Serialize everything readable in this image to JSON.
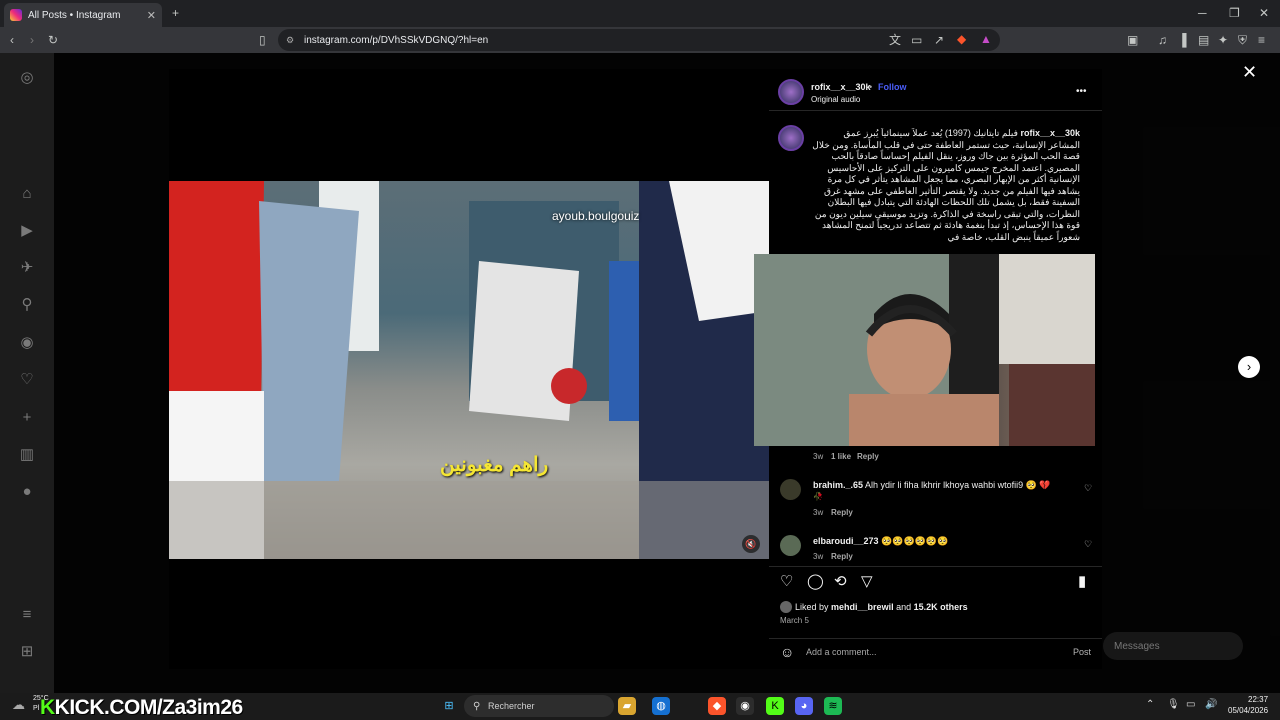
{
  "browser": {
    "tab_title": "All Posts • Instagram",
    "new_tab": "+",
    "url": "instagram.com/p/DVhSSkVDGNQ/?hl=en"
  },
  "post": {
    "username": "rofix__x__30k",
    "separator": "•",
    "follow_label": "Follow",
    "audio": "Original audio",
    "more_label": "•••",
    "video_watermark": "ayoub.boulgouiz",
    "video_caption": "راهم مغبونين",
    "caption_author": "rofix__x__30k",
    "caption_body": "فيلم تايتانيك (1997) يُعد عملاً سينمائياً يُبرز عمق المشاعر الإنسانية، حيث تستمر العاطفة حتى في قلب المأساة. ومن خلال قصة الحب المؤثرة بين جاك وروز، ينقل الفيلم إحساساً صادقاً بالحب المصيري. اعتمد المخرج جيمس كاميرون على التركيز على الأحاسيس الإنسانية أكثر من الإبهار البصري، مما يجعل المشاهد يتأثر في كل مرة يشاهد فيها الفيلم من جديد. ولا يقتصر التأثير العاطفي على مشهد غرق السفينة فقط، بل يشمل تلك اللحظات الهادئة التي يتبادل فيها البطلان النظرات، والتي تبقى راسخة في الذاكرة. وتزيد موسيقى سيلين ديون من قوة هذا الإحساس، إذ تبدأ بنغمة هادئة ثم تتصاعد تدريجياً لتمنح المشاهد شعوراً عميقاً ينبض القلب، خاصة في"
  },
  "comments": [
    {
      "time": "3w",
      "likes": "1 like",
      "reply": "Reply"
    },
    {
      "user": "brahim._.65",
      "text": "Alh ydir li fiha lkhrir lkhoya wahbi wtofii9 🥺 💔",
      "extra": "🥀",
      "time": "3w",
      "reply": "Reply"
    },
    {
      "user": "elbaroudi__273",
      "text": "🥺🥺🥺🥺🥺🥺",
      "time": "3w",
      "reply": "Reply"
    }
  ],
  "likes": {
    "prefix": "Liked by",
    "user": "mehdi__brewil",
    "and": "and",
    "count": "15.2K others",
    "date": "March 5"
  },
  "add_comment": {
    "placeholder": "Add a comment...",
    "post_label": "Post"
  },
  "messages": {
    "label": "Messages"
  },
  "taskbar": {
    "weather_temp": "25°C",
    "weather_short": "Pl",
    "search": "Rechercher",
    "time": "22:37",
    "date": "05/04/2026",
    "stream_overlay": "KICK.COM/Za3im26"
  },
  "colors": {
    "follow": "#4a5df9",
    "ig_background": "#000000",
    "caption_yellow": "#f5e633",
    "kick_green": "#53fc18"
  }
}
